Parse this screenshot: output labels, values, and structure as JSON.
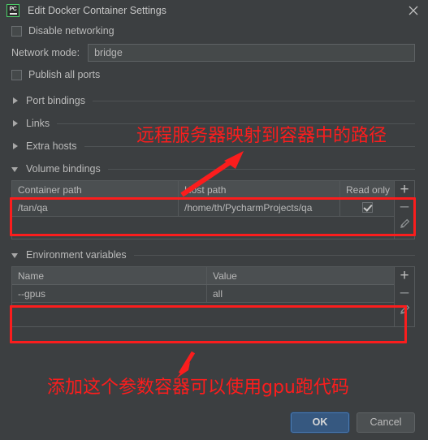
{
  "window": {
    "title": "Edit Docker Container Settings",
    "app_icon": "pycharm-pc-icon",
    "close_icon": "close-icon"
  },
  "form": {
    "disable_networking": {
      "label": "Disable networking",
      "checked": false
    },
    "network_mode": {
      "label": "Network mode:",
      "value": "bridge"
    },
    "publish_all_ports": {
      "label": "Publish all ports",
      "checked": false
    }
  },
  "sections": [
    {
      "label": "Port bindings",
      "expanded": false
    },
    {
      "label": "Links",
      "expanded": false
    },
    {
      "label": "Extra hosts",
      "expanded": false
    },
    {
      "label": "Volume bindings",
      "expanded": true
    },
    {
      "label": "Environment variables",
      "expanded": true
    }
  ],
  "volume_bindings": {
    "columns": [
      "Container path",
      "Host path",
      "Read only"
    ],
    "rows": [
      {
        "container_path": "/tan/qa",
        "host_path": "/home/th/PycharmProjects/qa",
        "read_only": true
      }
    ],
    "buttons": {
      "add": "+",
      "remove": "–",
      "edit": "pencil-icon"
    }
  },
  "environment_variables": {
    "columns": [
      "Name",
      "Value"
    ],
    "rows": [
      {
        "name": "--gpus",
        "value": "all"
      }
    ],
    "buttons": {
      "add": "+",
      "remove": "–",
      "edit": "pencil-icon"
    }
  },
  "footer": {
    "ok_label": "OK",
    "cancel_label": "Cancel"
  },
  "annotations": {
    "color": "#fb1d1d",
    "top_note": "远程服务器映射到容器中的路径",
    "bottom_note": "添加这个参数容器可以使用gpu跑代码"
  },
  "colors": {
    "dialog_bg": "#3c3f41",
    "field_bg": "#45494a",
    "table_header_bg": "#4b4f51",
    "table_row_bg": "#414547",
    "text": "#bbbbbb",
    "primary_button": "#365880",
    "accent_green": "#4ccf6a",
    "annotation_red": "#fb1d1d"
  }
}
